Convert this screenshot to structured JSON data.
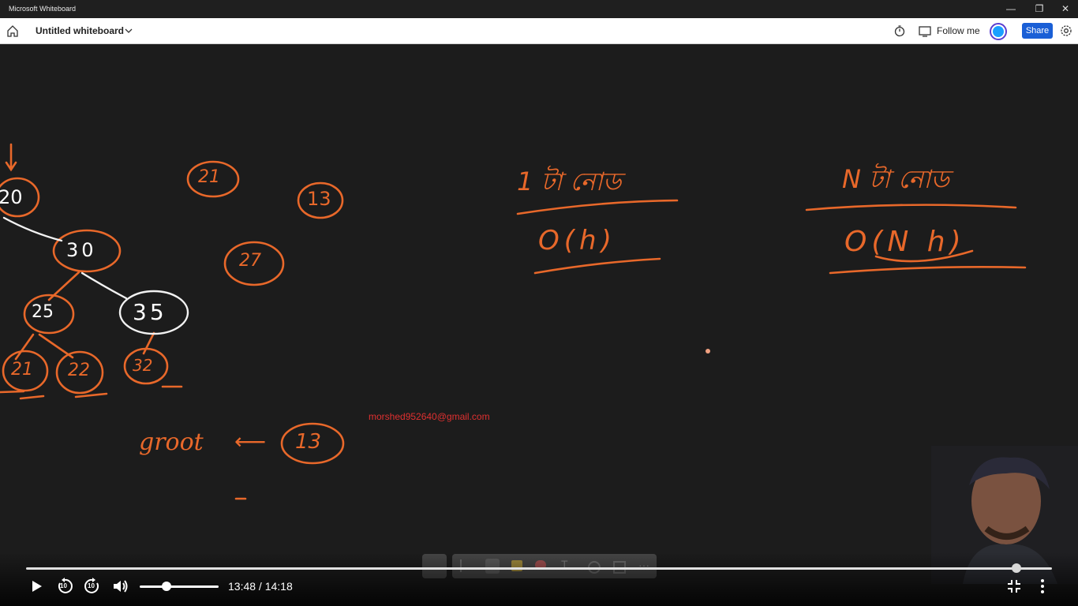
{
  "window": {
    "title": "Microsoft Whiteboard",
    "minimize": "—",
    "restore": "❐",
    "close": "✕"
  },
  "toolbar": {
    "board_title": "Untitled whiteboard",
    "follow_me": "Follow me",
    "share": "Share"
  },
  "board": {
    "tree_nodes": [
      "20",
      "30",
      "25",
      "35",
      "21",
      "22",
      "32"
    ],
    "floating_nodes": [
      "21",
      "13",
      "27"
    ],
    "root_text": "groot",
    "arrow_text": "⟵",
    "root_node": "13",
    "left_heading": "1 টা নোড",
    "left_complexity": "O(h)",
    "right_heading": "N টা নোড",
    "right_complexity": "O(N h)",
    "watermark": "morshed952640@gmail.com",
    "ink_color": "#e8682a"
  },
  "player": {
    "time": "13:48 / 14:18",
    "progress_fraction": 0.965,
    "volume_fraction": 0.34,
    "rewind_label": "10",
    "forward_label": "10"
  }
}
